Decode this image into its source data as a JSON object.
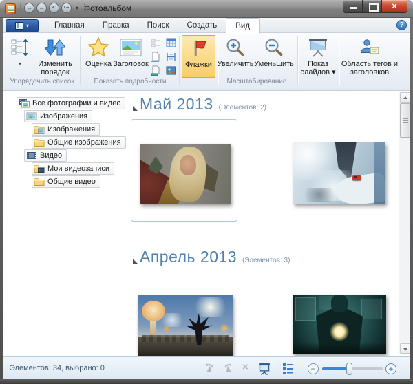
{
  "window": {
    "title": "Фотоальбом"
  },
  "icons": {
    "caret_down": "▾",
    "back": "←",
    "forward": "→",
    "undo": "↶",
    "redo": "↷",
    "close": "×",
    "help": "?",
    "delete": "×",
    "minus": "−",
    "plus": "+"
  },
  "tabs": {
    "active_tab": "Вид",
    "items": [
      {
        "label": "Главная"
      },
      {
        "label": "Правка"
      },
      {
        "label": "Поиск"
      },
      {
        "label": "Создать"
      },
      {
        "label": "Вид"
      }
    ]
  },
  "ribbon": {
    "arrange": {
      "label": "Упорядочить список",
      "change_order": "Изменить порядок"
    },
    "details": {
      "label": "Показать подробности",
      "rating": "Оценка",
      "caption": "Заголовок",
      "flags": "Флажки"
    },
    "zoom": {
      "label": "Масштабирование",
      "zoom_in": "Увеличить",
      "zoom_out": "Уменьшить"
    },
    "slideshow": {
      "label": "Показ слайдов"
    },
    "tags_pane": {
      "label": "Область тегов и заголовков"
    }
  },
  "sidebar": {
    "items": [
      {
        "label": "Все фотографии и видео",
        "level": 0,
        "icon": "all-media-icon"
      },
      {
        "label": "Изображения",
        "level": 1,
        "icon": "pictures-icon"
      },
      {
        "label": "Изображения",
        "level": 2,
        "icon": "folder-pictures-icon"
      },
      {
        "label": "Общие изображения",
        "level": 2,
        "icon": "folder-icon"
      },
      {
        "label": "Видео",
        "level": 1,
        "icon": "video-icon"
      },
      {
        "label": "Мои видеозаписи",
        "level": 2,
        "icon": "folder-video-icon"
      },
      {
        "label": "Общие видео",
        "level": 2,
        "icon": "folder-icon"
      }
    ]
  },
  "content": {
    "groups": [
      {
        "title": "Май 2013",
        "count": "(Элементов: 2)",
        "thumbnails": [
          {
            "name": "fantasy-portrait"
          },
          {
            "name": "snowy-mountain-red-car"
          }
        ],
        "selected_thumbnail": 0
      },
      {
        "title": "Апрель 2013",
        "count": "(Элементов: 3)",
        "thumbnails": [
          {
            "name": "explosion-winged-figure"
          },
          {
            "name": "armored-figure-glow"
          }
        ]
      }
    ]
  },
  "statusbar": {
    "items_text": "Элементов: 34, выбрано: 0",
    "zoom_slider_position": 0.42
  },
  "colors": {
    "accent_blue": "#3a7bd0",
    "flag_red": "#e03c28",
    "flags_highlight": "#fbdd90",
    "header_blue": "#5080ad",
    "status_bg": "#e6eff8",
    "titlebar_gray": "#8f8f8f"
  }
}
